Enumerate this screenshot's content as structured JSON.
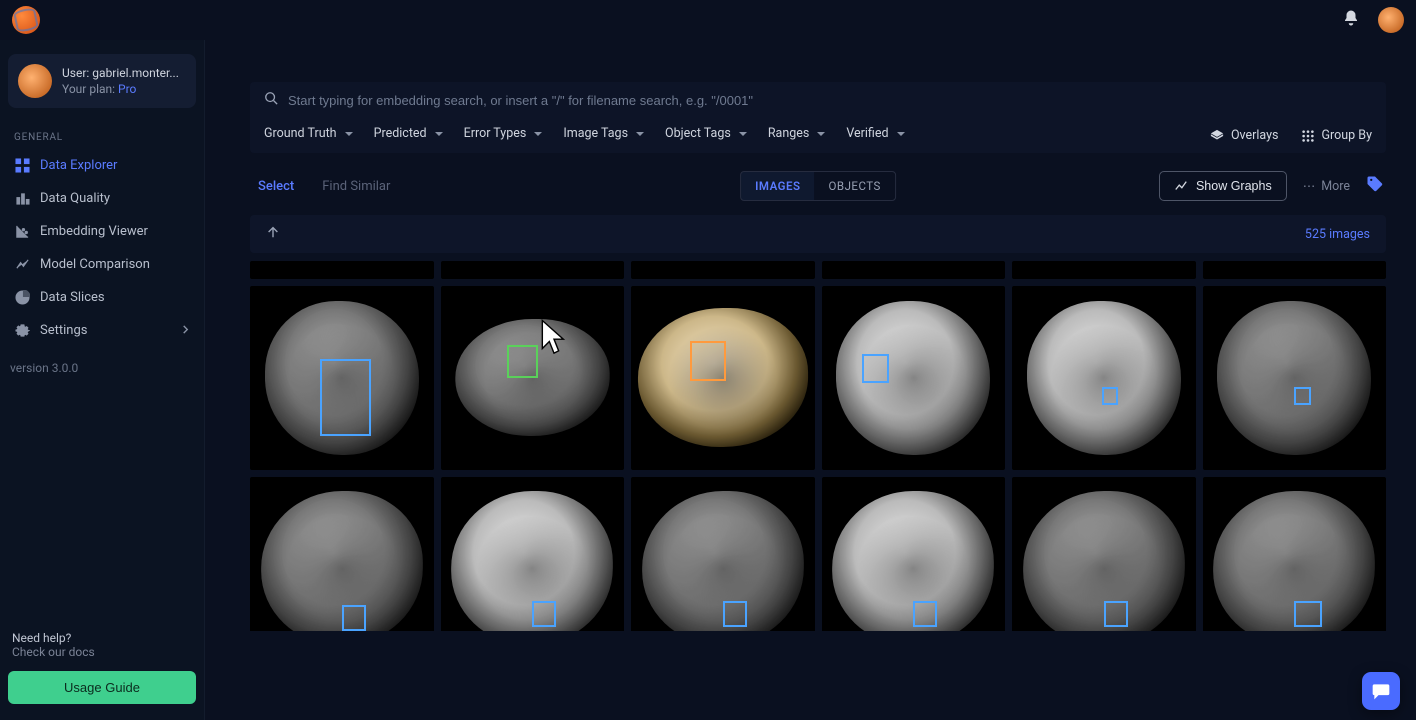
{
  "topbar": {
    "bell": "notifications"
  },
  "user": {
    "label_prefix": "User:",
    "name": "gabriel.monter...",
    "plan_label": "Your plan:",
    "plan_value": "Pro"
  },
  "sidebar": {
    "section": "GENERAL",
    "items": [
      {
        "label": "Data Explorer",
        "icon": "grid",
        "active": true
      },
      {
        "label": "Data Quality",
        "icon": "bars",
        "active": false
      },
      {
        "label": "Embedding Viewer",
        "icon": "scatter",
        "active": false
      },
      {
        "label": "Model Comparison",
        "icon": "compare",
        "active": false
      },
      {
        "label": "Data Slices",
        "icon": "pie",
        "active": false
      },
      {
        "label": "Settings",
        "icon": "gear",
        "active": false,
        "chevron": true
      }
    ],
    "version": "version 3.0.0",
    "help_title": "Need help?",
    "help_sub": "Check our docs",
    "usage_button": "Usage Guide"
  },
  "search": {
    "placeholder": "Start typing for embedding search, or insert a \"/\" for filename search, e.g. \"/0001\""
  },
  "filters": [
    "Ground Truth",
    "Predicted",
    "Error Types",
    "Image Tags",
    "Object Tags",
    "Ranges",
    "Verified"
  ],
  "tools": {
    "overlays": "Overlays",
    "groupby": "Group By"
  },
  "controls": {
    "select": "Select",
    "find_similar": "Find Similar",
    "seg_images": "IMAGES",
    "seg_objects": "OBJECTS",
    "show_graphs": "Show Graphs",
    "more": "More",
    "count": "525 images"
  }
}
